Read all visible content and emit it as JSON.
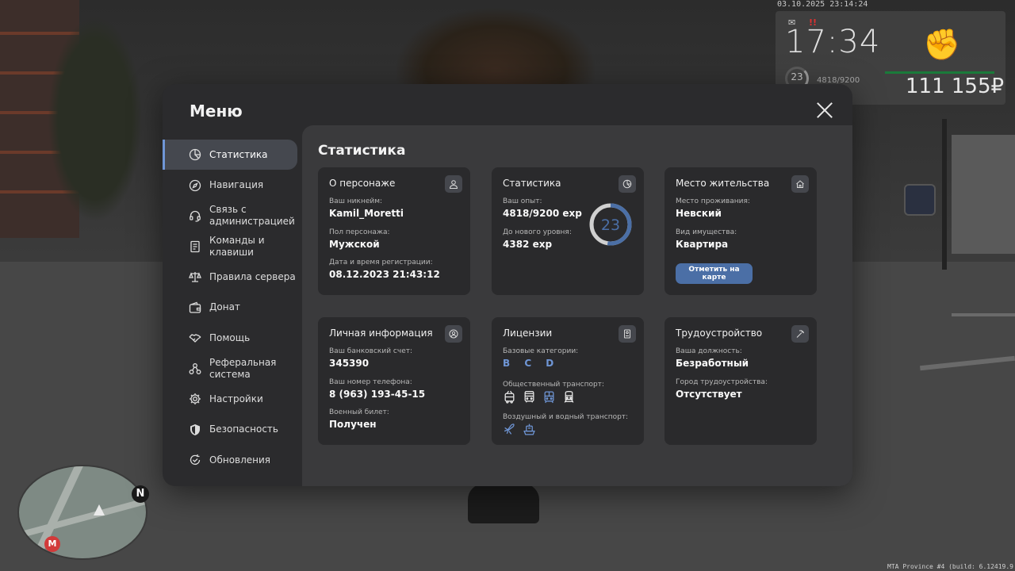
{
  "hud": {
    "timestamp": "03.10.2025 23:14:24",
    "time": "17:34",
    "level": "23",
    "exp": "4818/9200",
    "money": "111 155₽"
  },
  "minimap": {
    "north": "N",
    "metro": "M"
  },
  "build_info": "MTA Province #4 (build: 6.12419.9",
  "menu": {
    "title": "Меню",
    "sidebar": [
      {
        "label": "Статистика",
        "icon": "pie-chart-icon",
        "active": true
      },
      {
        "label": "Навигация",
        "icon": "compass-icon"
      },
      {
        "label": "Связь с администрацией",
        "icon": "headset-icon"
      },
      {
        "label": "Команды и клавиши",
        "icon": "document-icon"
      },
      {
        "label": "Правила сервера",
        "icon": "scales-icon"
      },
      {
        "label": "Донат",
        "icon": "wallet-icon"
      },
      {
        "label": "Помощь",
        "icon": "handshake-icon"
      },
      {
        "label": "Реферальная система",
        "icon": "referral-icon"
      },
      {
        "label": "Настройки",
        "icon": "gear-icon"
      },
      {
        "label": "Безопасность",
        "icon": "shield-icon"
      },
      {
        "label": "Обновления",
        "icon": "update-icon"
      }
    ]
  },
  "content": {
    "title": "Статистика",
    "character": {
      "title": "О персонаже",
      "nickname_label": "Ваш никнейм:",
      "nickname": "Kamil_Moretti",
      "gender_label": "Пол персонажа:",
      "gender": "Мужской",
      "reg_label": "Дата и время регистрации:",
      "reg": "08.12.2023 21:43:12"
    },
    "stats": {
      "title": "Статистика",
      "exp_label": "Ваш опыт:",
      "exp": "4818/9200 exp",
      "next_label": "До нового уровня:",
      "next": "4382 exp",
      "level": "23",
      "progress": 0.524
    },
    "residence": {
      "title": "Место жительства",
      "place_label": "Место проживания:",
      "place": "Невский",
      "property_label": "Вид имущества:",
      "property": "Квартира",
      "button": "Отметить на карте"
    },
    "personal": {
      "title": "Личная информация",
      "bank_label": "Ваш банковский счет:",
      "bank": "345390",
      "phone_label": "Ваш номер телефона:",
      "phone": "8 (963) 193-45-15",
      "military_label": "Военный билет:",
      "military": "Получен"
    },
    "licenses": {
      "title": "Лицензии",
      "base_label": "Базовые категории:",
      "categories": "B C D",
      "public_label": "Общественный транспорт:",
      "air_label": "Воздушный и водный транспорт:"
    },
    "employment": {
      "title": "Трудоустройство",
      "position_label": "Ваша должность:",
      "position": "Безработный",
      "city_label": "Город трудоустройства:",
      "city": "Отсутствует"
    }
  }
}
